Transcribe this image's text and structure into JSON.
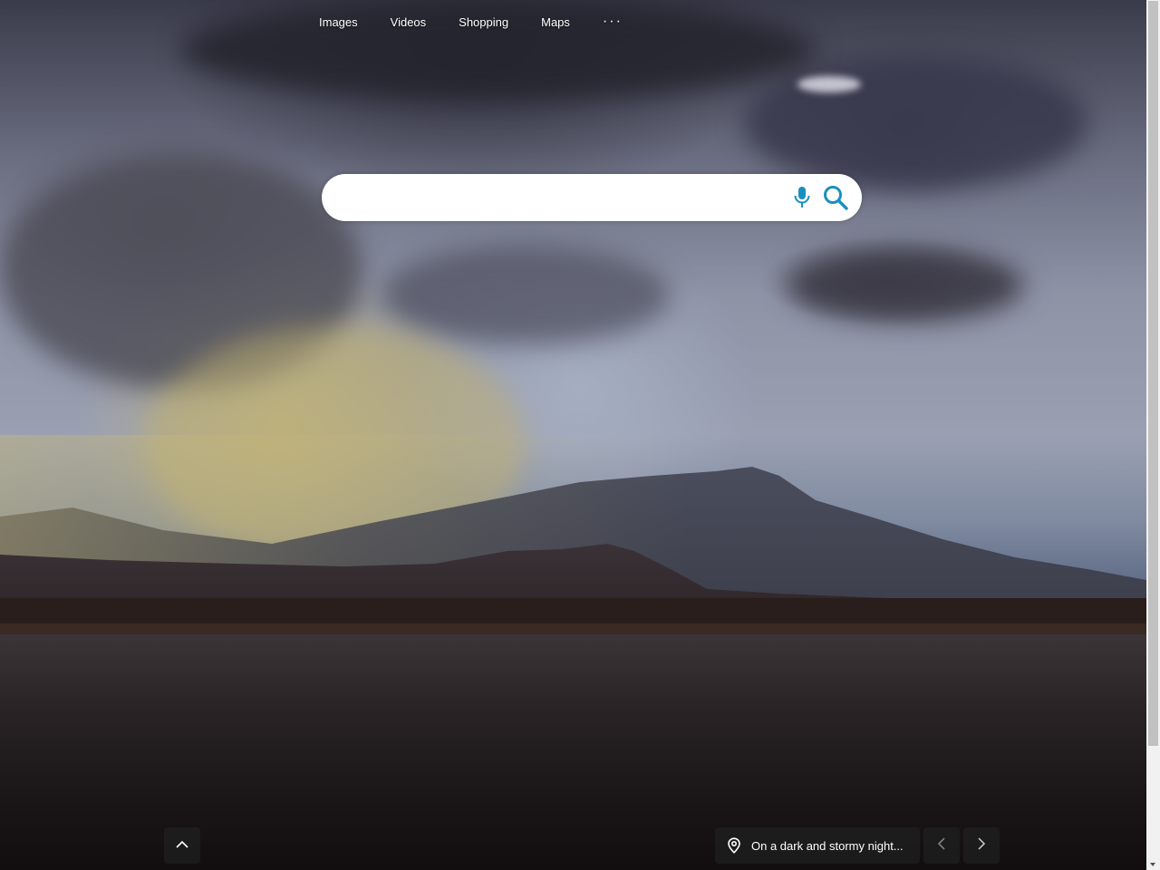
{
  "nav": {
    "items": [
      {
        "label": "Images"
      },
      {
        "label": "Videos"
      },
      {
        "label": "Shopping"
      },
      {
        "label": "Maps"
      }
    ],
    "more_label": "···"
  },
  "search": {
    "value": "",
    "placeholder": "",
    "mic_icon": "microphone-icon",
    "search_icon": "search-icon",
    "accent_color": "#1a8fbf"
  },
  "footer": {
    "scroll_up_icon": "chevron-up-icon",
    "caption_icon": "location-pin-icon",
    "caption_text": "On a dark and stormy night...",
    "prev_icon": "chevron-left-icon",
    "next_icon": "chevron-right-icon"
  },
  "background": {
    "image_icon": "stormy-lake-landscape"
  }
}
